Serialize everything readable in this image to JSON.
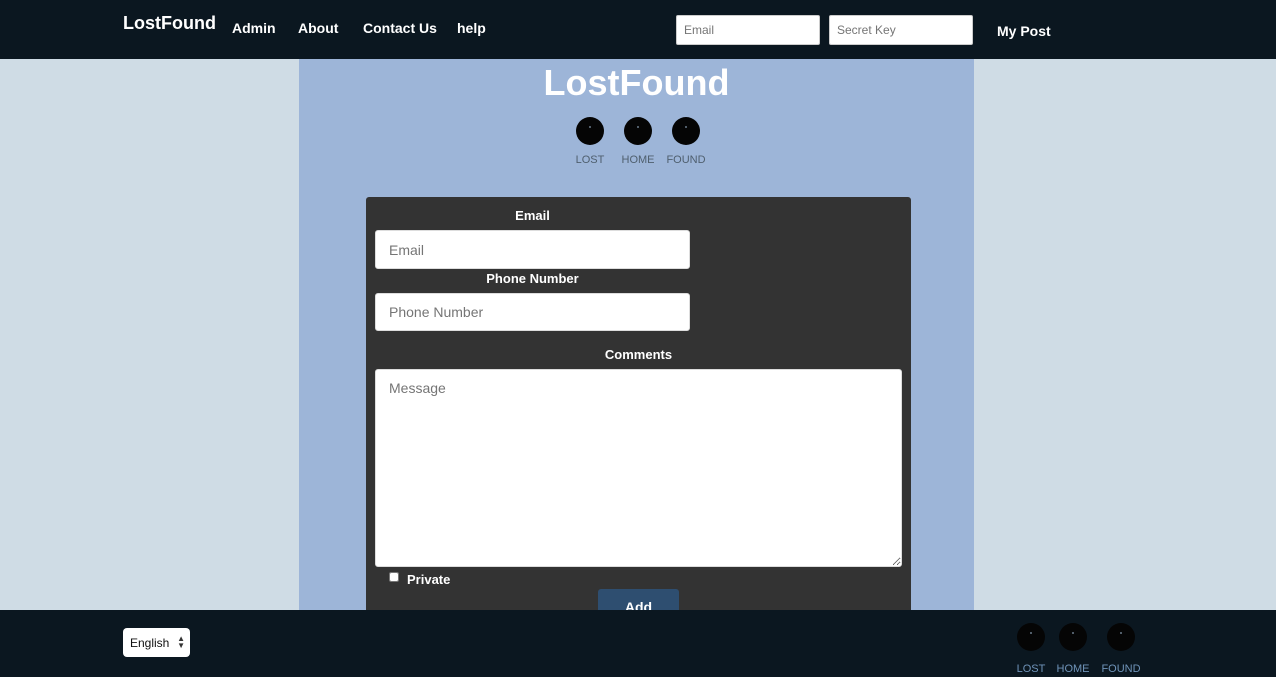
{
  "header": {
    "brand": "LostFound",
    "nav": [
      "Admin",
      "About",
      "Contact Us",
      "help"
    ],
    "email_placeholder": "Email",
    "secret_key_placeholder": "Secret Key",
    "my_post": "My Post"
  },
  "main": {
    "title": "LostFound",
    "circle_nav": [
      "LOST",
      "HOME",
      "FOUND"
    ]
  },
  "form": {
    "email_label": "Email",
    "email_placeholder": "Email",
    "phone_label": "Phone Number",
    "phone_placeholder": "Phone Number",
    "comments_label": "Comments",
    "message_placeholder": "Message",
    "private_label": "Private",
    "private_checked": false,
    "add_button": "Add"
  },
  "footer": {
    "language": "English",
    "circle_nav": [
      "LOST",
      "HOME",
      "FOUND"
    ]
  },
  "colors": {
    "navbar": "#0b1720",
    "page_background": "#cfdce5",
    "panel": "#9db5d8",
    "form": "#333333",
    "button": "#2e4e70"
  }
}
